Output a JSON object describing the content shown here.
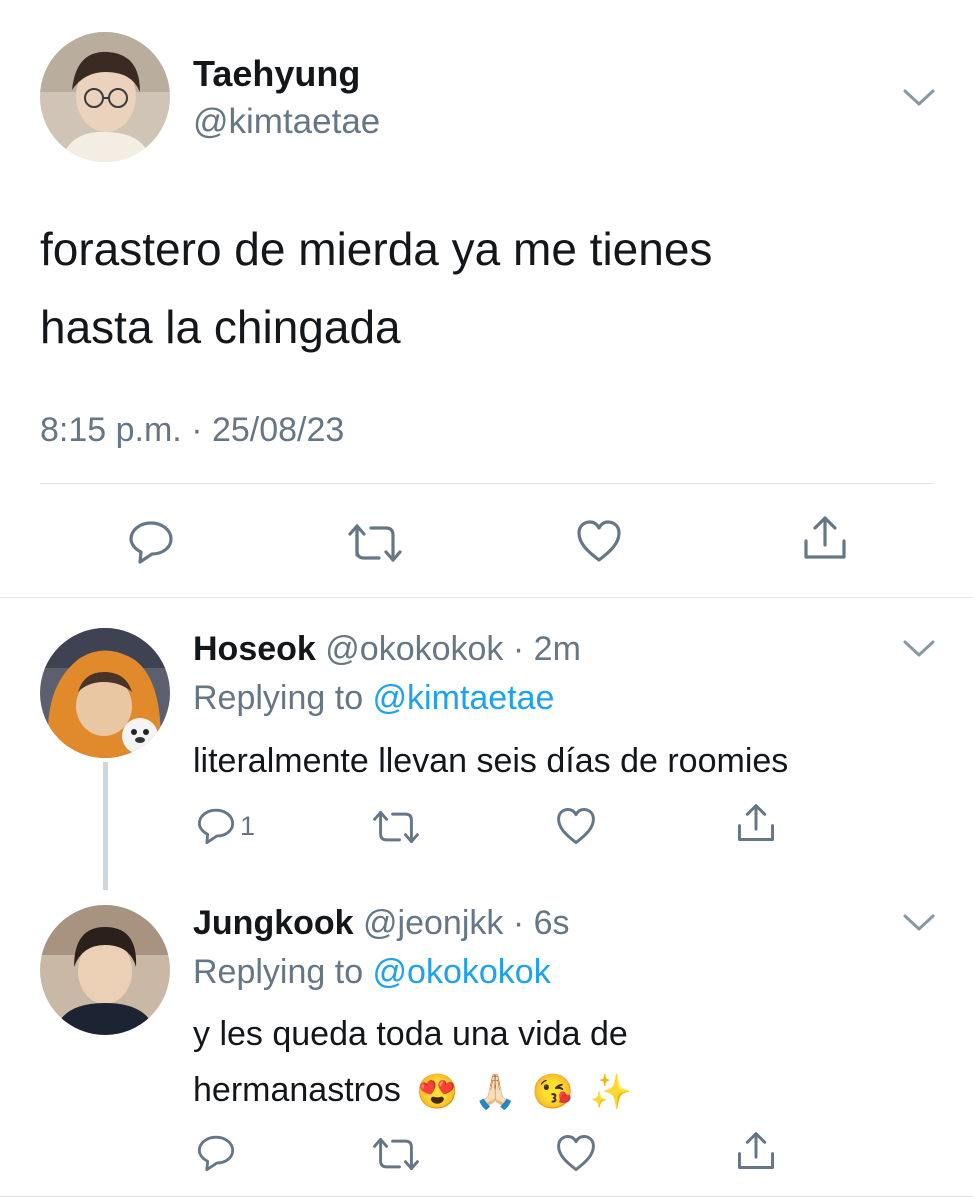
{
  "main_tweet": {
    "name": "Taehyung",
    "handle": "@kimtaetae",
    "text_line1": "forastero de mierda ya me tienes",
    "text_line2": "hasta la chingada",
    "timestamp": "8:15 p.m. · 25/08/23",
    "icons": [
      "chevron-down-icon",
      "reply-icon",
      "retweet-icon",
      "like-icon",
      "share-icon"
    ]
  },
  "replies": [
    {
      "name": "Hoseok",
      "handle": "@okokokok",
      "separator": " · ",
      "time": "2m",
      "replying_prefix": "Replying to ",
      "replying_to": "@kimtaetae",
      "text": "literalmente llevan seis días de roomies",
      "reply_count": "1"
    },
    {
      "name": "Jungkook",
      "handle": "@jeonjkk",
      "separator": " · ",
      "time": "6s",
      "replying_prefix": "Replying to ",
      "replying_to": "@okokokok",
      "text_line1": "y les queda toda una vida de",
      "text_line2": "hermanastros",
      "emojis": [
        "😍",
        "🙏🏻",
        "😘",
        "✨"
      ]
    }
  ],
  "colors": {
    "text": "#14171a",
    "secondary": "#657786",
    "link": "#1da1f2",
    "divider": "#e1e8ed",
    "thread_line": "#ccd6dd"
  }
}
